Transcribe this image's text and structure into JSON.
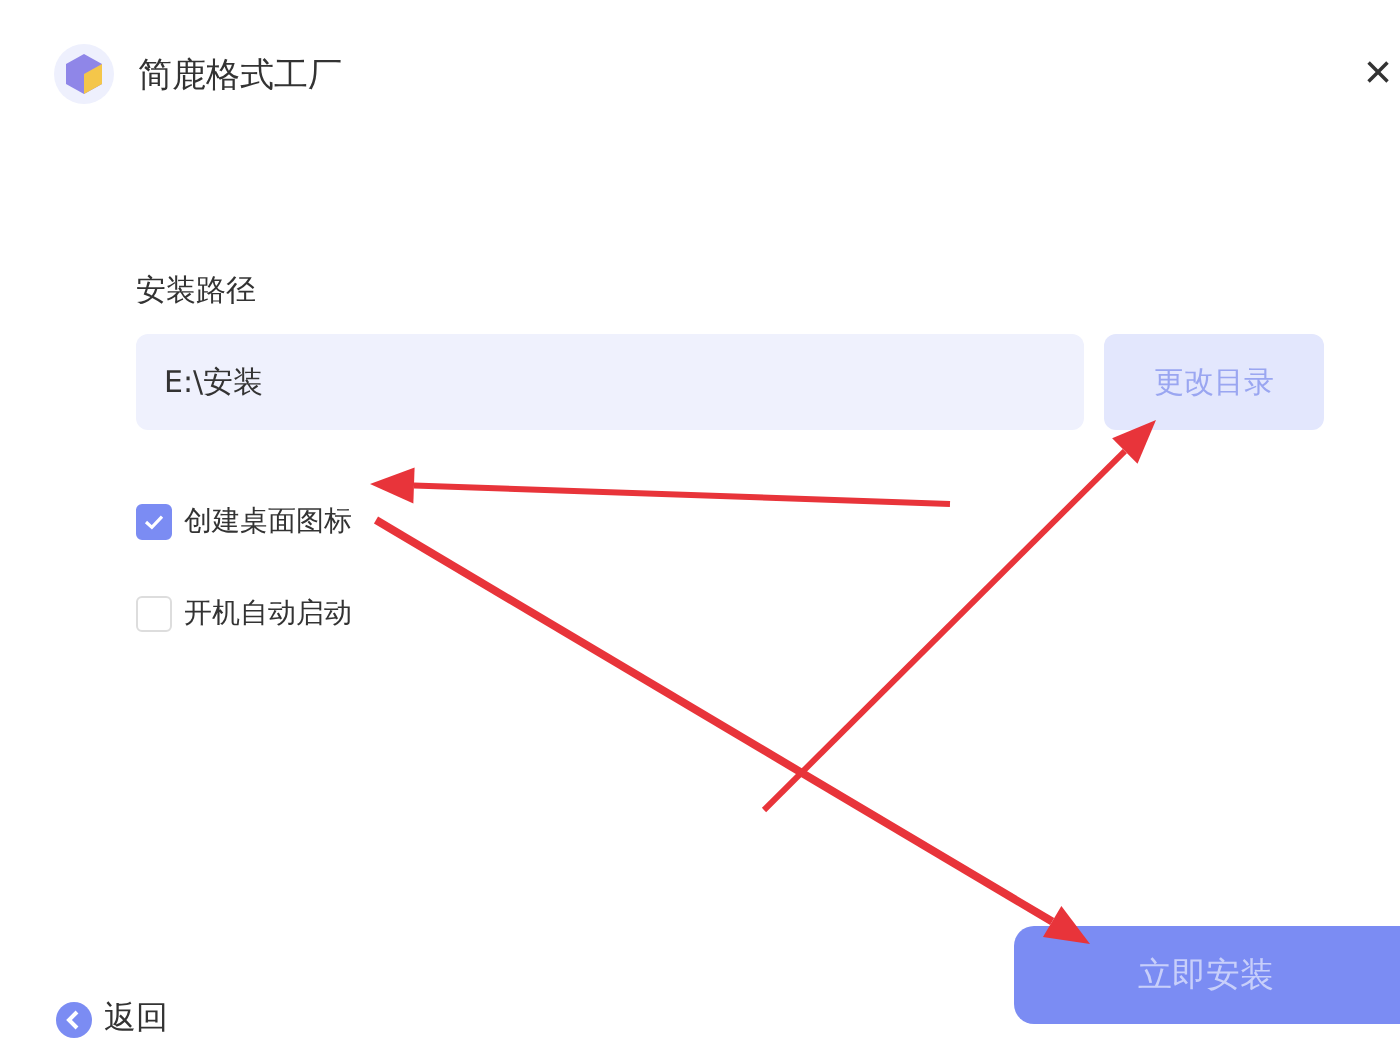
{
  "window": {
    "title": "简鹿格式工厂",
    "close": "×"
  },
  "install_path": {
    "label": "安装路径",
    "value": "E:\\安装",
    "change_button": "更改目录"
  },
  "options": [
    {
      "label": "创建桌面图标",
      "checked": true
    },
    {
      "label": "开机自动启动",
      "checked": false
    }
  ],
  "back": "返回",
  "install_button": "立即安装"
}
